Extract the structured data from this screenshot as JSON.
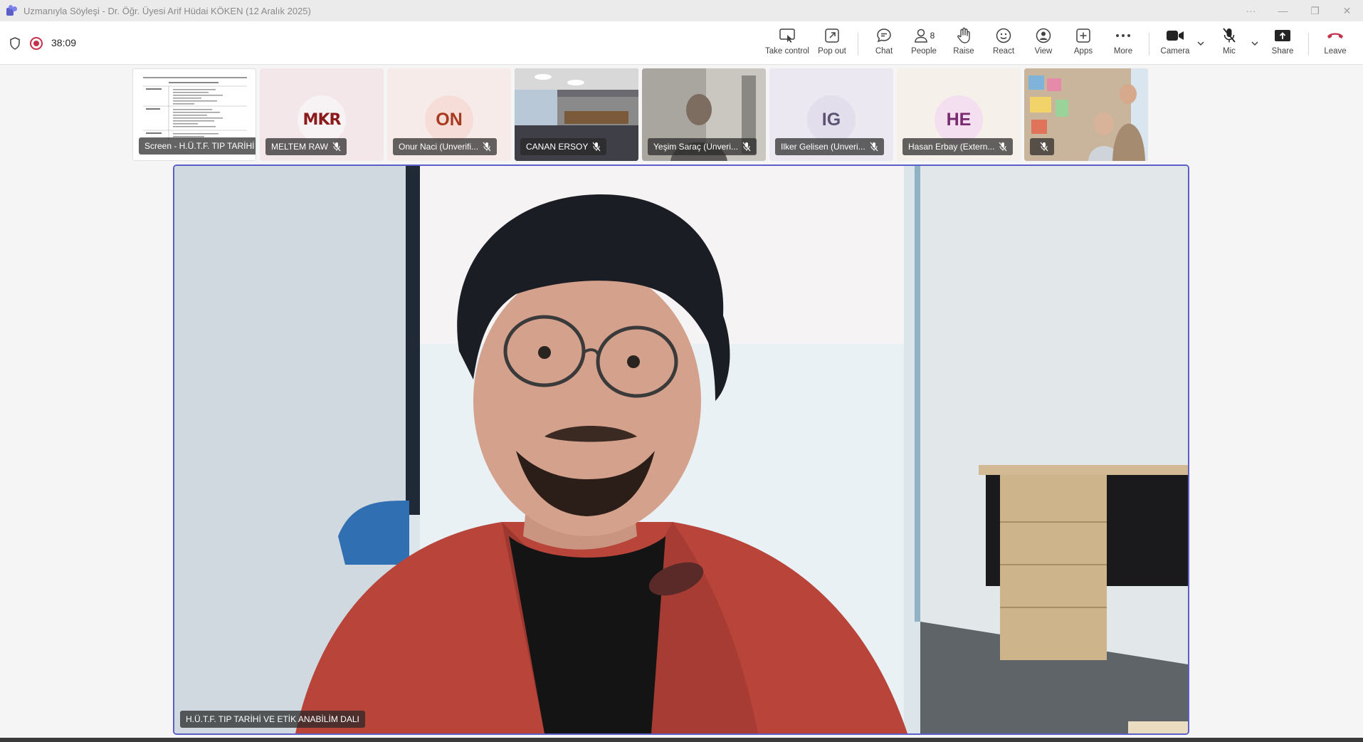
{
  "window": {
    "title": "Uzmanıyla Söyleşi - Dr. Öğr. Üyesi Arif Hüdai KÖKEN (12 Aralık 2025)",
    "more": "···",
    "minimize": "—",
    "restore": "❐",
    "close": "✕"
  },
  "meeting": {
    "timer": "38:09"
  },
  "toolbar": {
    "take_control": "Take control",
    "pop_out": "Pop out",
    "chat": "Chat",
    "people": "People",
    "people_count": "8",
    "raise": "Raise",
    "react": "React",
    "view": "View",
    "apps": "Apps",
    "more": "More",
    "camera": "Camera",
    "mic": "Mic",
    "share": "Share",
    "leave": "Leave"
  },
  "participants": [
    {
      "name": "Screen - H.Ü.T.F. TIP TARİHİ VE ETİK...",
      "type": "screen"
    },
    {
      "name": "MELTEM RAW",
      "initials": "MKR",
      "type": "logo"
    },
    {
      "name": "Onur Naci (Unverifi...",
      "initials": "ON",
      "type": "avatar"
    },
    {
      "name": "CANAN ERSOY",
      "type": "video"
    },
    {
      "name": "Yeşim Saraç (Unveri...",
      "type": "video"
    },
    {
      "name": "Ilker Gelisen (Unveri...",
      "initials": "IG",
      "type": "avatar"
    },
    {
      "name": "Hasan Erbay (Extern...",
      "initials": "HE",
      "type": "avatar"
    },
    {
      "name": "",
      "type": "video"
    }
  ],
  "stage": {
    "label": "H.Ü.T.F. TIP TARİHİ VE ETİK ANABİLİM DALI"
  },
  "colors": {
    "accent": "#5b5fc7",
    "leave": "#c4314b",
    "recording": "#c4314b"
  }
}
